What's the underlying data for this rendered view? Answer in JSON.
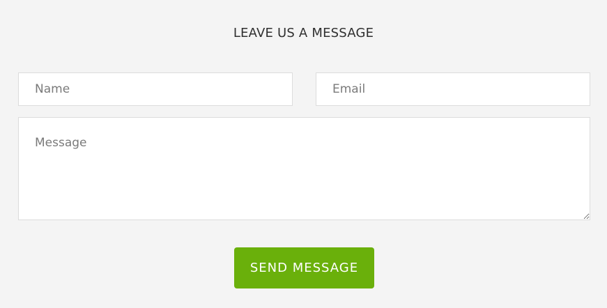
{
  "contact_form": {
    "title": "LEAVE US A MESSAGE",
    "name": {
      "value": "",
      "placeholder": "Name"
    },
    "email": {
      "value": "",
      "placeholder": "Email"
    },
    "message": {
      "value": "",
      "placeholder": "Message"
    },
    "send_button": {
      "label": "SEND MESSAGE"
    }
  },
  "colors": {
    "background": "#f4f4f4",
    "title_text": "#2f2f2f",
    "input_border": "#dcdcdc",
    "placeholder_text": "#7a7a7a",
    "button_background": "#6ab00b",
    "button_text": "#ffffff"
  }
}
